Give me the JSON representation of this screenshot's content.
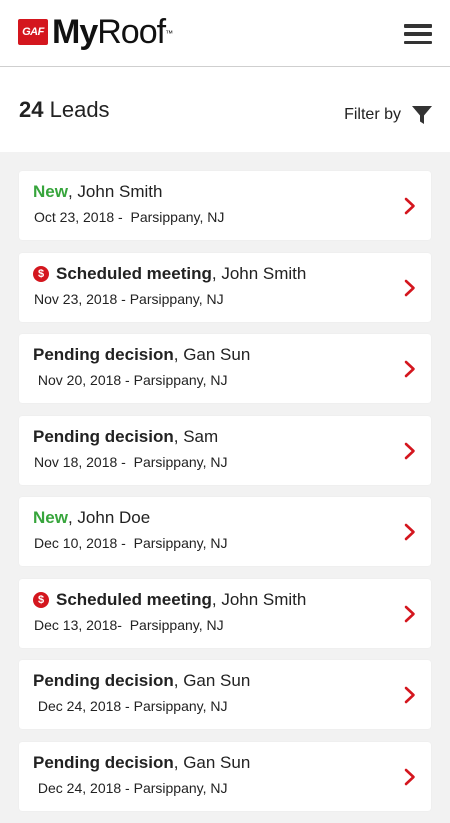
{
  "app": {
    "badge": "GAF",
    "brand_bold": "My",
    "brand_light": "Roof",
    "tm": "™"
  },
  "summary": {
    "count": "24",
    "label": "Leads",
    "filter_label": "Filter by"
  },
  "colors": {
    "accent": "#d4161e",
    "new_status": "#37a53c"
  },
  "leads": [
    {
      "status": "New",
      "status_type": "new",
      "has_dollar": false,
      "name": ", John Smith",
      "details": "Oct 23, 2018 -  Parsippany, NJ"
    },
    {
      "status": "Scheduled meeting",
      "status_type": "default",
      "has_dollar": true,
      "name": ", John Smith",
      "details": "Nov 23, 2018 - Parsippany, NJ"
    },
    {
      "status": "Pending decision",
      "status_type": "default",
      "has_dollar": false,
      "name": ", Gan Sun",
      "details": " Nov 20, 2018 - Parsippany, NJ"
    },
    {
      "status": "Pending decision",
      "status_type": "default",
      "has_dollar": false,
      "name": ", Sam",
      "details": "Nov 18, 2018 -  Parsippany, NJ"
    },
    {
      "status": "New",
      "status_type": "new",
      "has_dollar": false,
      "name": ", John Doe",
      "details": "Dec 10, 2018 -  Parsippany, NJ"
    },
    {
      "status": "Scheduled meeting",
      "status_type": "default",
      "has_dollar": true,
      "name": ", John Smith",
      "details": "Dec 13, 2018-  Parsippany, NJ"
    },
    {
      "status": "Pending decision",
      "status_type": "default",
      "has_dollar": false,
      "name": ", Gan Sun",
      "details": " Dec 24, 2018 - Parsippany, NJ"
    },
    {
      "status": "Pending decision",
      "status_type": "default",
      "has_dollar": false,
      "name": ", Gan Sun",
      "details": " Dec 24, 2018 - Parsippany, NJ"
    }
  ],
  "icons": {
    "menu": "hamburger-menu-icon",
    "filter": "funnel-filter-icon",
    "chevron": "chevron-right-icon",
    "dollar": "dollar-circle-icon",
    "dollar_glyph": "$"
  }
}
